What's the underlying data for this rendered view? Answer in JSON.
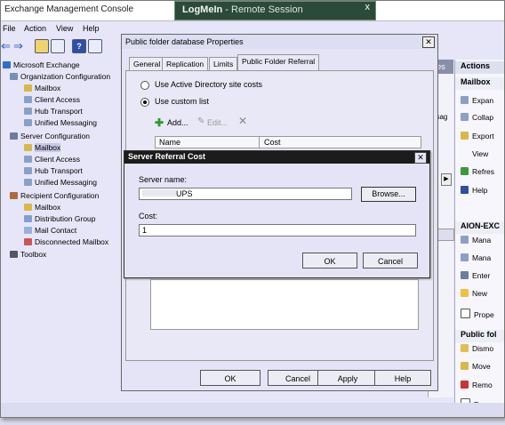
{
  "window": {
    "title": "Exchange Management Console"
  },
  "remote": {
    "title": "LogMeIn",
    "subtitle": "- Remote Session",
    "close": "x"
  },
  "menu": [
    "File",
    "Action",
    "View",
    "Help"
  ],
  "tree": {
    "root": "Microsoft Exchange",
    "org_config": "Organization Configuration",
    "org_items": [
      "Mailbox",
      "Client Access",
      "Hub Transport",
      "Unified Messaging"
    ],
    "server_config": "Server Configuration",
    "server_items": [
      "Mailbox",
      "Client Access",
      "Hub Transport",
      "Unified Messaging"
    ],
    "recipient_config": "Recipient Configuration",
    "recipient_items": [
      "Mailbox",
      "Distribution Group",
      "Mail Contact",
      "Disconnected Mailbox"
    ],
    "toolbox": "Toolbox"
  },
  "results": {
    "tab_fragment": "es",
    "col_fragment": "essag"
  },
  "actions": {
    "header": "Actions",
    "section1": "Mailbox",
    "items1": [
      "Expan",
      "Collap",
      "Export",
      "View",
      "Refres",
      "Help"
    ],
    "section2": "AION-EXC",
    "items2": [
      "Mana",
      "Mana",
      "Enter",
      "New",
      "Prope"
    ],
    "section3": "Public fol",
    "items3": [
      "Dismo",
      "Move",
      "Remo",
      "Prope"
    ]
  },
  "props": {
    "title": "Public folder database Properties",
    "tabs": [
      "General",
      "Replication",
      "Limits",
      "Public Folder Referral"
    ],
    "radio_ad": "Use Active Directory site costs",
    "radio_custom": "Use custom list",
    "add": "Add...",
    "edit": "Edit...",
    "col_name": "Name",
    "col_cost": "Cost",
    "ok": "OK",
    "cancel": "Cancel",
    "apply": "Apply",
    "help": "Help"
  },
  "src": {
    "title": "Server Referral Cost",
    "server_label": "Server name:",
    "server_value": "UPS",
    "browse": "Browse...",
    "cost_label": "Cost:",
    "cost_value": "1",
    "ok": "OK",
    "cancel": "Cancel"
  },
  "colors": {
    "accent": "#1c1c1c",
    "logmein": "#2b4a3a",
    "selected": "#c7c7e8"
  }
}
